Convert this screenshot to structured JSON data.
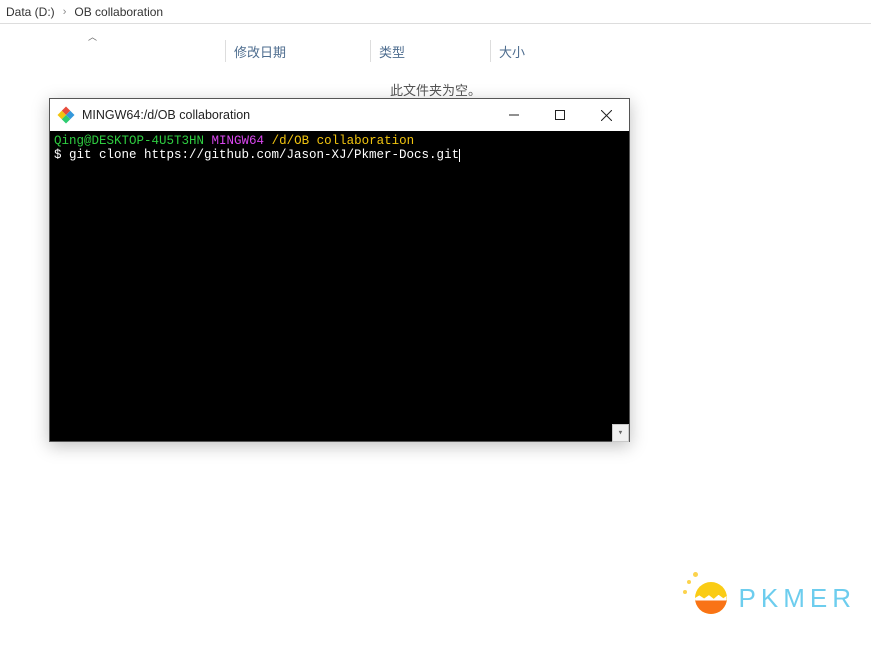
{
  "breadcrumb": {
    "root": "Data (D:)",
    "folder": "OB collaboration"
  },
  "columns": {
    "date_modified": "修改日期",
    "type": "类型",
    "size": "大小"
  },
  "empty_message": "此文件夹为空。",
  "terminal": {
    "title": "MINGW64:/d/OB collaboration",
    "prompt": {
      "user_host": "Qing@DESKTOP-4U5T3HN",
      "shell": "MINGW64",
      "path": "/d/OB collaboration"
    },
    "command_line": "$ git clone https://github.com/Jason-XJ/Pkmer-Docs.git"
  },
  "watermark": {
    "text": "PKMER"
  }
}
